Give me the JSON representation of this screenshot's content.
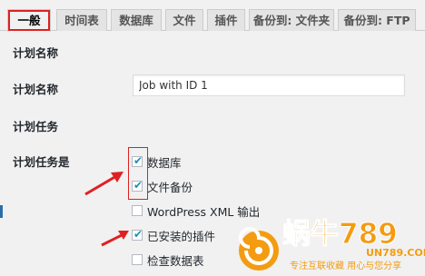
{
  "tabs": [
    {
      "label": "一般",
      "active": true
    },
    {
      "label": "时间表"
    },
    {
      "label": "数据库"
    },
    {
      "label": "文件"
    },
    {
      "label": "插件"
    },
    {
      "label": "备份到: 文件夹"
    },
    {
      "label": "备份到: FTP"
    }
  ],
  "section_job_name": "计划名称",
  "job_name_label": "计划名称",
  "job_name_value": "Job with ID 1",
  "section_job_tasks": "计划任务",
  "job_tasks_label": "计划任务是",
  "tasks": [
    {
      "label": "数据库",
      "checked": true
    },
    {
      "label": "文件备份",
      "checked": true
    },
    {
      "label": "WordPress XML 输出",
      "checked": false
    },
    {
      "label": "已安装的插件",
      "checked": true
    },
    {
      "label": "检查数据表",
      "checked": false
    }
  ],
  "watermark": {
    "brand": "蜗牛789",
    "domain": "UN789.COM",
    "slogan": "专注互联收藏  用心与您分享"
  },
  "colors": {
    "annotation_red": "#e02020",
    "checkmark_blue": "#1e8cbe",
    "logo_orange": "#f39c12"
  }
}
